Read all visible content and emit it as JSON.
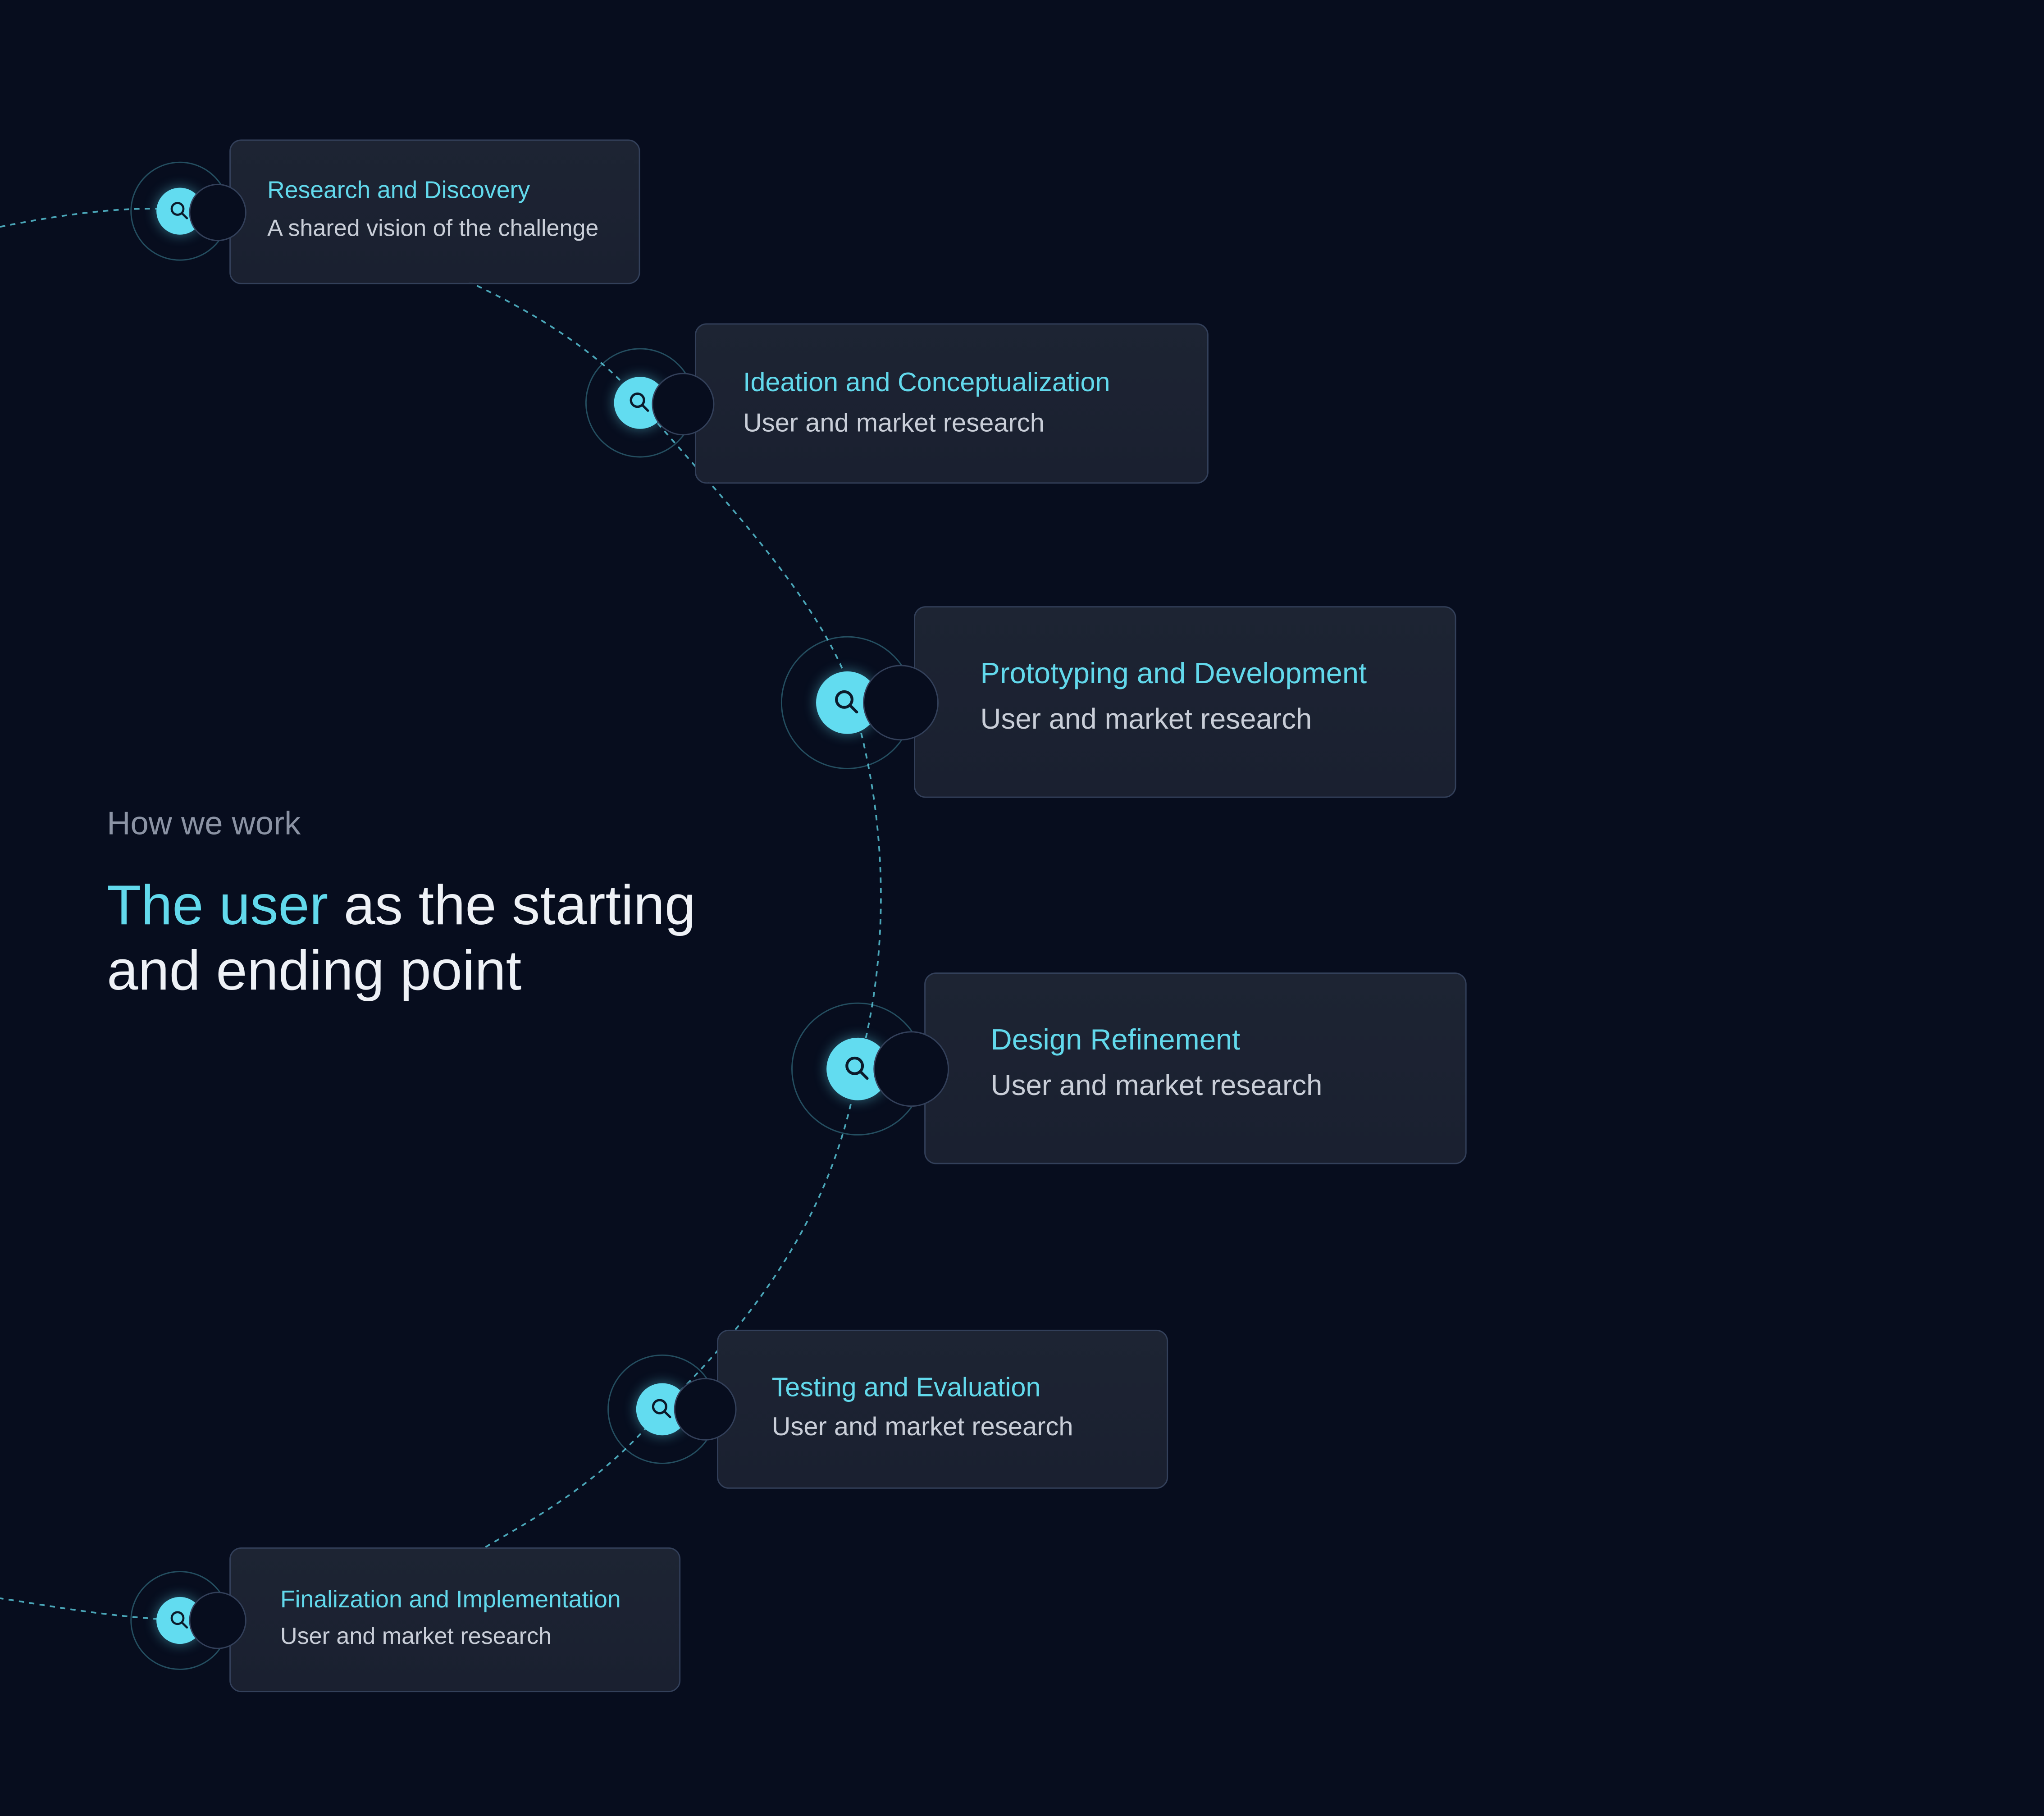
{
  "intro": {
    "kicker": "How we work",
    "headline_accent": "The user",
    "headline_rest": " as the starting and ending point"
  },
  "steps": [
    {
      "title": "Research and Discovery",
      "subtitle": "A shared vision of the challenge",
      "icon": "search-icon"
    },
    {
      "title": "Ideation and Conceptualization",
      "subtitle": "User and market research",
      "icon": "search-icon"
    },
    {
      "title": "Prototyping and Development",
      "subtitle": "User and market research",
      "icon": "search-icon"
    },
    {
      "title": "Design Refinement",
      "subtitle": "User and market research",
      "icon": "search-icon"
    },
    {
      "title": "Testing and Evaluation",
      "subtitle": "User and market research",
      "icon": "search-icon"
    },
    {
      "title": "Finalization and Implementation",
      "subtitle": "User and market research",
      "icon": "search-icon"
    }
  ],
  "colors": {
    "background": "#070d1e",
    "accent": "#62d9ec",
    "card": "#1c2232",
    "card_border": "#33405a",
    "text_primary": "#eef1f6",
    "text_muted": "#8b93a4"
  }
}
